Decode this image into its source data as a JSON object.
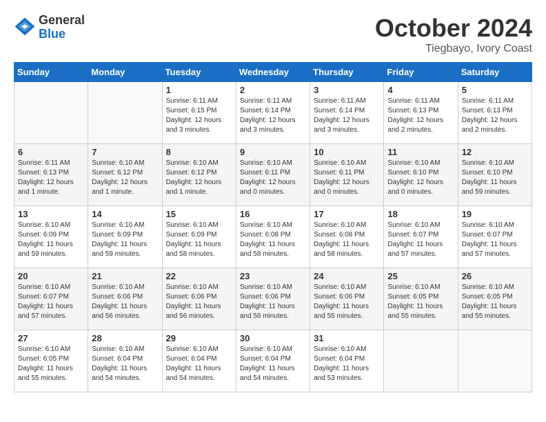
{
  "logo": {
    "general": "General",
    "blue": "Blue"
  },
  "title": "October 2024",
  "location": "Tiegbayo, Ivory Coast",
  "days_of_week": [
    "Sunday",
    "Monday",
    "Tuesday",
    "Wednesday",
    "Thursday",
    "Friday",
    "Saturday"
  ],
  "weeks": [
    [
      {
        "day": "",
        "info": ""
      },
      {
        "day": "",
        "info": ""
      },
      {
        "day": "1",
        "info": "Sunrise: 6:11 AM\nSunset: 6:15 PM\nDaylight: 12 hours and 3 minutes."
      },
      {
        "day": "2",
        "info": "Sunrise: 6:11 AM\nSunset: 6:14 PM\nDaylight: 12 hours and 3 minutes."
      },
      {
        "day": "3",
        "info": "Sunrise: 6:11 AM\nSunset: 6:14 PM\nDaylight: 12 hours and 3 minutes."
      },
      {
        "day": "4",
        "info": "Sunrise: 6:11 AM\nSunset: 6:13 PM\nDaylight: 12 hours and 2 minutes."
      },
      {
        "day": "5",
        "info": "Sunrise: 6:11 AM\nSunset: 6:13 PM\nDaylight: 12 hours and 2 minutes."
      }
    ],
    [
      {
        "day": "6",
        "info": "Sunrise: 6:11 AM\nSunset: 6:13 PM\nDaylight: 12 hours and 1 minute."
      },
      {
        "day": "7",
        "info": "Sunrise: 6:10 AM\nSunset: 6:12 PM\nDaylight: 12 hours and 1 minute."
      },
      {
        "day": "8",
        "info": "Sunrise: 6:10 AM\nSunset: 6:12 PM\nDaylight: 12 hours and 1 minute."
      },
      {
        "day": "9",
        "info": "Sunrise: 6:10 AM\nSunset: 6:11 PM\nDaylight: 12 hours and 0 minutes."
      },
      {
        "day": "10",
        "info": "Sunrise: 6:10 AM\nSunset: 6:11 PM\nDaylight: 12 hours and 0 minutes."
      },
      {
        "day": "11",
        "info": "Sunrise: 6:10 AM\nSunset: 6:10 PM\nDaylight: 12 hours and 0 minutes."
      },
      {
        "day": "12",
        "info": "Sunrise: 6:10 AM\nSunset: 6:10 PM\nDaylight: 11 hours and 59 minutes."
      }
    ],
    [
      {
        "day": "13",
        "info": "Sunrise: 6:10 AM\nSunset: 6:09 PM\nDaylight: 11 hours and 59 minutes."
      },
      {
        "day": "14",
        "info": "Sunrise: 6:10 AM\nSunset: 6:09 PM\nDaylight: 11 hours and 59 minutes."
      },
      {
        "day": "15",
        "info": "Sunrise: 6:10 AM\nSunset: 6:09 PM\nDaylight: 11 hours and 58 minutes."
      },
      {
        "day": "16",
        "info": "Sunrise: 6:10 AM\nSunset: 6:08 PM\nDaylight: 11 hours and 58 minutes."
      },
      {
        "day": "17",
        "info": "Sunrise: 6:10 AM\nSunset: 6:08 PM\nDaylight: 11 hours and 58 minutes."
      },
      {
        "day": "18",
        "info": "Sunrise: 6:10 AM\nSunset: 6:07 PM\nDaylight: 11 hours and 57 minutes."
      },
      {
        "day": "19",
        "info": "Sunrise: 6:10 AM\nSunset: 6:07 PM\nDaylight: 11 hours and 57 minutes."
      }
    ],
    [
      {
        "day": "20",
        "info": "Sunrise: 6:10 AM\nSunset: 6:07 PM\nDaylight: 11 hours and 57 minutes."
      },
      {
        "day": "21",
        "info": "Sunrise: 6:10 AM\nSunset: 6:06 PM\nDaylight: 11 hours and 56 minutes."
      },
      {
        "day": "22",
        "info": "Sunrise: 6:10 AM\nSunset: 6:06 PM\nDaylight: 11 hours and 56 minutes."
      },
      {
        "day": "23",
        "info": "Sunrise: 6:10 AM\nSunset: 6:06 PM\nDaylight: 11 hours and 56 minutes."
      },
      {
        "day": "24",
        "info": "Sunrise: 6:10 AM\nSunset: 6:06 PM\nDaylight: 11 hours and 55 minutes."
      },
      {
        "day": "25",
        "info": "Sunrise: 6:10 AM\nSunset: 6:05 PM\nDaylight: 11 hours and 55 minutes."
      },
      {
        "day": "26",
        "info": "Sunrise: 6:10 AM\nSunset: 6:05 PM\nDaylight: 11 hours and 55 minutes."
      }
    ],
    [
      {
        "day": "27",
        "info": "Sunrise: 6:10 AM\nSunset: 6:05 PM\nDaylight: 11 hours and 55 minutes."
      },
      {
        "day": "28",
        "info": "Sunrise: 6:10 AM\nSunset: 6:04 PM\nDaylight: 11 hours and 54 minutes."
      },
      {
        "day": "29",
        "info": "Sunrise: 6:10 AM\nSunset: 6:04 PM\nDaylight: 11 hours and 54 minutes."
      },
      {
        "day": "30",
        "info": "Sunrise: 6:10 AM\nSunset: 6:04 PM\nDaylight: 11 hours and 54 minutes."
      },
      {
        "day": "31",
        "info": "Sunrise: 6:10 AM\nSunset: 6:04 PM\nDaylight: 11 hours and 53 minutes."
      },
      {
        "day": "",
        "info": ""
      },
      {
        "day": "",
        "info": ""
      }
    ]
  ]
}
